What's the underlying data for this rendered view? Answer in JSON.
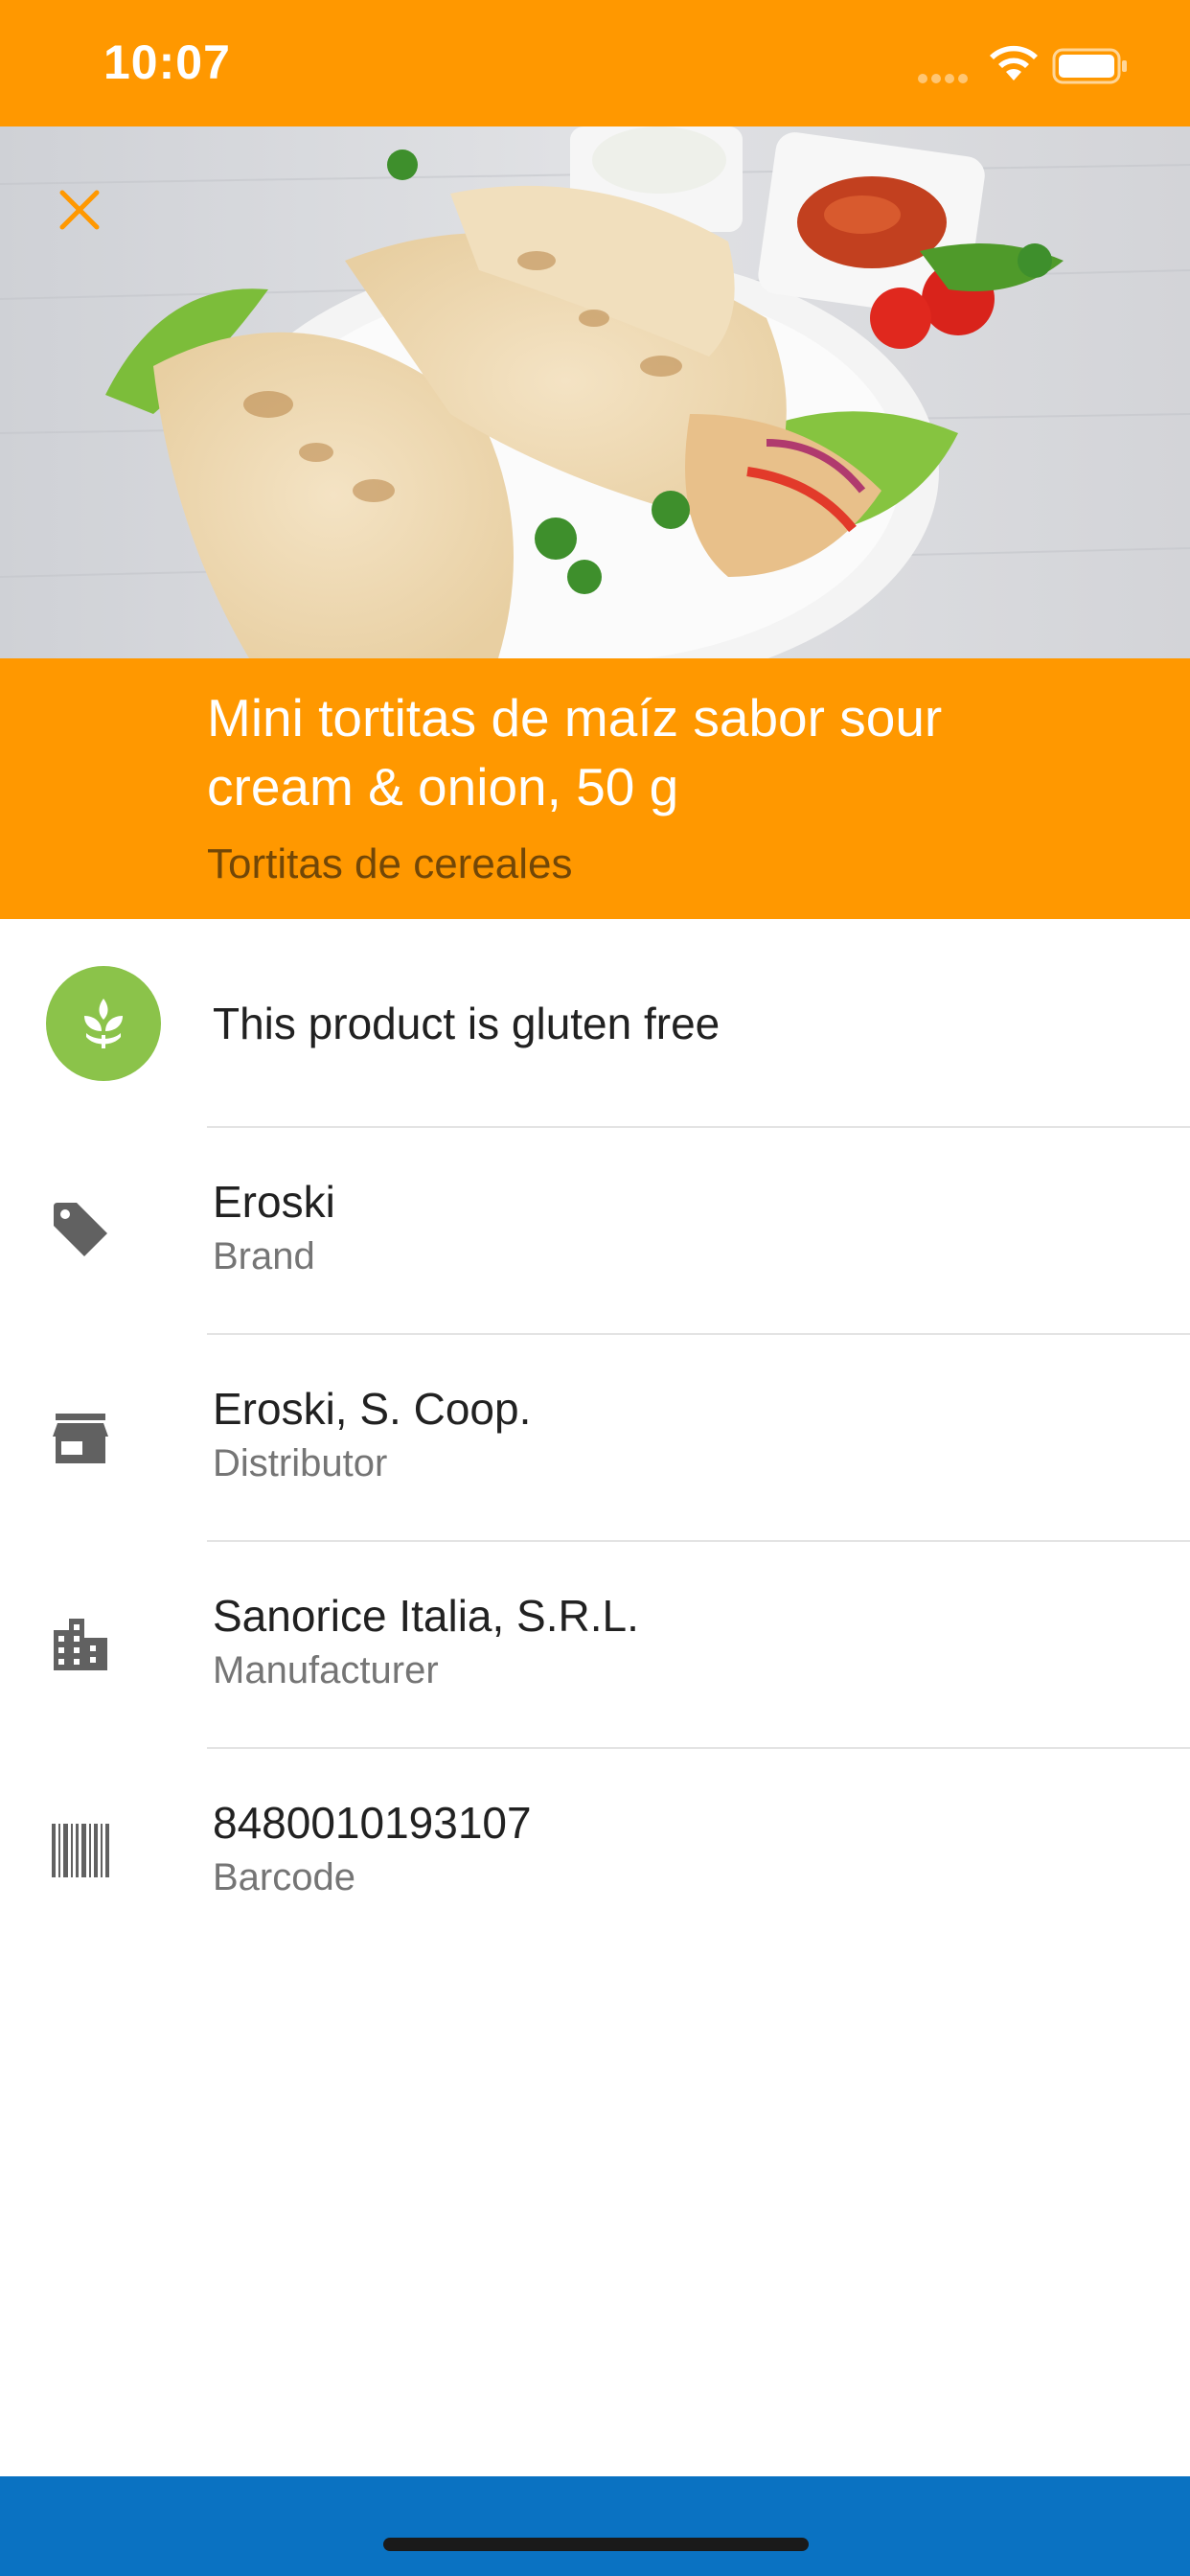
{
  "status_bar": {
    "time": "10:07"
  },
  "product": {
    "title": "Mini tortitas de maíz sabor sour cream & onion, 50 g",
    "category": "Tortitas de cereales"
  },
  "gluten": {
    "text": "This product is gluten free",
    "icon": "wheat-icon"
  },
  "details": [
    {
      "value": "Eroski",
      "label": "Brand",
      "icon": "tag-icon"
    },
    {
      "value": "Eroski, S. Coop.",
      "label": "Distributor",
      "icon": "store-icon"
    },
    {
      "value": "Sanorice Italia, S.R.L.",
      "label": "Manufacturer",
      "icon": "building-icon"
    },
    {
      "value": "8480010193107",
      "label": "Barcode",
      "icon": "barcode-icon"
    }
  ],
  "colors": {
    "accent": "#FF9800",
    "gluten_badge": "#8BC34A",
    "bottom_bar": "#0A72C2",
    "icon_gray": "#616161"
  }
}
